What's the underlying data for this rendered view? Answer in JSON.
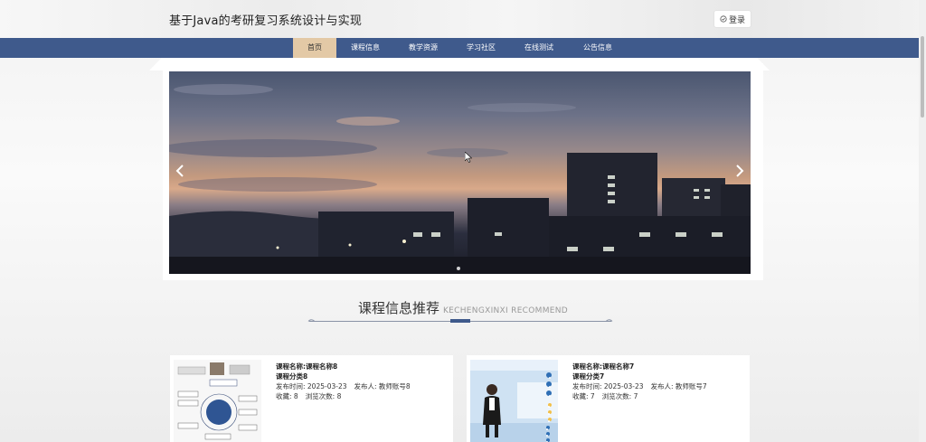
{
  "header": {
    "title": "基于Java的考研复习系统设计与实现",
    "login_label": "登录"
  },
  "nav": {
    "items": [
      {
        "label": "首页",
        "active": true
      },
      {
        "label": "课程信息",
        "active": false
      },
      {
        "label": "教学资源",
        "active": false
      },
      {
        "label": "学习社区",
        "active": false
      },
      {
        "label": "在线测试",
        "active": false
      },
      {
        "label": "公告信息",
        "active": false
      }
    ]
  },
  "banner": {
    "prev_icon": "chevron-left-icon",
    "next_icon": "chevron-right-icon"
  },
  "section": {
    "title_cn": "课程信息推荐",
    "title_en": "KECHENGXINXI RECOMMEND"
  },
  "cards": [
    {
      "name": "课程名称:课程名称8",
      "category": "课程分类8",
      "publish_time": "发布时间:    2025-03-23",
      "publisher": "发布人:  教师账号8",
      "favorites": "收藏:  8",
      "views": "浏览次数:  8"
    },
    {
      "name": "课程名称:课程名称7",
      "category": "课程分类7",
      "publish_time": "发布时间:    2025-03-23",
      "publisher": "发布人:  教师账号7",
      "favorites": "收藏:  7",
      "views": "浏览次数:  7"
    }
  ],
  "colors": {
    "nav_bg": "#3f5a8c",
    "nav_active": "#e3c9a6"
  }
}
